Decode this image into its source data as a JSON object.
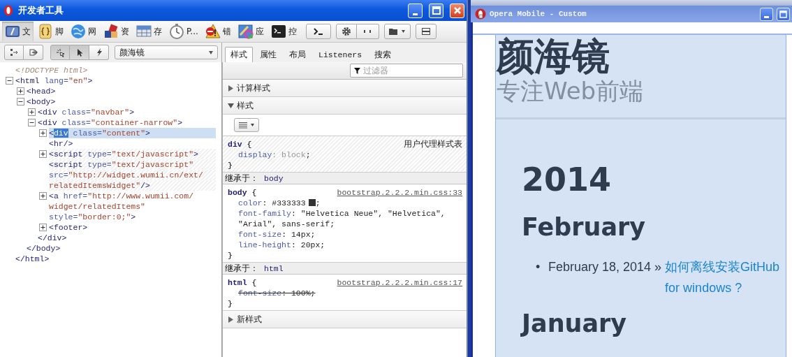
{
  "devtools": {
    "title": "开发者工具",
    "tools": [
      {
        "label": "文",
        "selected": true
      },
      {
        "label": "脚",
        "selected": false
      },
      {
        "label": "网",
        "selected": false
      },
      {
        "label": "资",
        "selected": false
      },
      {
        "label": "存",
        "selected": false
      },
      {
        "label": "P...",
        "selected": false
      },
      {
        "label": "错",
        "selected": false
      },
      {
        "label": "应",
        "selected": false
      },
      {
        "label": "控",
        "selected": false
      }
    ],
    "pick_modes": [
      {
        "selected": true
      },
      {
        "selected": true
      },
      {
        "selected": false
      }
    ],
    "document_select": {
      "value": "颜海镜"
    },
    "panel_tabs": [
      {
        "label": "样式",
        "selected": true
      },
      {
        "label": "属性",
        "selected": false
      },
      {
        "label": "布局",
        "selected": false
      },
      {
        "label": "Listeners",
        "selected": false
      },
      {
        "label": "搜索",
        "selected": false
      }
    ],
    "filter": {
      "placeholder": "过滤器"
    },
    "dom_tree": [
      {
        "lines": [
          [
            {
              "kind": "doctype",
              "text": "<!DOCTYPE html>"
            }
          ]
        ],
        "selected": false,
        "hatched": false
      },
      {
        "lines": [
          [
            {
              "kind": "tag",
              "text": "<html"
            },
            {
              "kind": "attr",
              "text": " lang="
            },
            {
              "kind": "value",
              "text": "\"en\""
            },
            {
              "kind": "tag",
              "text": ">"
            }
          ]
        ],
        "expanded": true,
        "selected": false,
        "hatched": false,
        "closing": [
          {
            "kind": "tag",
            "text": "</html>"
          }
        ],
        "children": [
          {
            "lines": [
              [
                {
                  "kind": "tag",
                  "text": "<head>"
                }
              ]
            ],
            "expanded": false,
            "selected": false,
            "hatched": false
          },
          {
            "lines": [
              [
                {
                  "kind": "tag",
                  "text": "<body>"
                }
              ]
            ],
            "expanded": true,
            "selected": false,
            "hatched": false,
            "closing": [
              {
                "kind": "tag",
                "text": "</body>"
              }
            ],
            "children": [
              {
                "lines": [
                  [
                    {
                      "kind": "tag",
                      "text": "<div"
                    },
                    {
                      "kind": "attr",
                      "text": " class="
                    },
                    {
                      "kind": "value",
                      "text": "\"navbar\""
                    },
                    {
                      "kind": "tag",
                      "text": ">"
                    }
                  ]
                ],
                "expanded": false,
                "selected": false,
                "hatched": false
              },
              {
                "lines": [
                  [
                    {
                      "kind": "tag",
                      "text": "<div"
                    },
                    {
                      "kind": "attr",
                      "text": " class="
                    },
                    {
                      "kind": "value",
                      "text": "\"container-narrow\""
                    },
                    {
                      "kind": "tag",
                      "text": ">"
                    }
                  ]
                ],
                "expanded": true,
                "selected": false,
                "hatched": false,
                "closing": [
                  {
                    "kind": "tag",
                    "text": "</div>"
                  }
                ],
                "children": [
                  {
                    "lines": [
                      [
                        {
                          "kind": "tag",
                          "text": "<"
                        },
                        {
                          "kind": "highlight",
                          "text": "div"
                        },
                        {
                          "kind": "attr",
                          "text": " class="
                        },
                        {
                          "kind": "value",
                          "text": "\"content\""
                        },
                        {
                          "kind": "tag",
                          "text": ">"
                        }
                      ]
                    ],
                    "expanded": false,
                    "selected": true,
                    "hatched": false
                  },
                  {
                    "lines": [
                      [
                        {
                          "kind": "tag",
                          "text": "<hr/>"
                        }
                      ]
                    ],
                    "selected": false,
                    "hatched": false
                  },
                  {
                    "lines": [
                      [
                        {
                          "kind": "tag",
                          "text": "<script"
                        },
                        {
                          "kind": "attr",
                          "text": " type="
                        },
                        {
                          "kind": "value",
                          "text": "\"text/javascript\""
                        },
                        {
                          "kind": "tag",
                          "text": ">"
                        }
                      ]
                    ],
                    "expanded": false,
                    "selected": false,
                    "hatched": true
                  },
                  {
                    "lines": [
                      [
                        {
                          "kind": "tag",
                          "text": "<script"
                        },
                        {
                          "kind": "attr",
                          "text": " type="
                        },
                        {
                          "kind": "value",
                          "text": "\"text/javascript\""
                        }
                      ],
                      [
                        {
                          "kind": "attr",
                          "text": "src="
                        },
                        {
                          "kind": "value",
                          "text": "\"http://widget.wumii.cn/ext/"
                        }
                      ],
                      [
                        {
                          "kind": "value",
                          "text": "relatedItemsWidget\""
                        },
                        {
                          "kind": "tag",
                          "text": "/>"
                        }
                      ]
                    ],
                    "selected": false,
                    "hatched": true
                  },
                  {
                    "lines": [
                      [
                        {
                          "kind": "tag",
                          "text": "<a"
                        },
                        {
                          "kind": "attr",
                          "text": " href="
                        },
                        {
                          "kind": "value",
                          "text": "\"http://www.wumii.com/"
                        }
                      ],
                      [
                        {
                          "kind": "value",
                          "text": "widget/relatedItems\""
                        }
                      ],
                      [
                        {
                          "kind": "attr",
                          "text": "style="
                        },
                        {
                          "kind": "value",
                          "text": "\"border:0;\""
                        },
                        {
                          "kind": "tag",
                          "text": ">"
                        }
                      ]
                    ],
                    "expanded": false,
                    "selected": false,
                    "hatched": false
                  },
                  {
                    "lines": [
                      [
                        {
                          "kind": "tag",
                          "text": "<footer>"
                        }
                      ]
                    ],
                    "expanded": false,
                    "selected": false,
                    "hatched": false
                  }
                ]
              }
            ]
          }
        ]
      }
    ],
    "style_sections": [
      {
        "label": "计算样式",
        "expanded": false
      },
      {
        "label": "样式",
        "expanded": true,
        "blocks": [
          {
            "kind": "rule",
            "selector": "div",
            "open": " {",
            "close": "}",
            "origin": "用户代理样式表",
            "user_agent": true,
            "declarations": [
              {
                "property": "display",
                "value": ": block",
                "end": ";",
                "overridden": false
              }
            ]
          },
          {
            "kind": "inherited",
            "label": "继承于：",
            "selector": "body"
          },
          {
            "kind": "rule",
            "selector": "body",
            "open": " {",
            "close": "}",
            "origin": "bootstrap.2.2.2.min.css:33",
            "user_agent": false,
            "declarations": [
              {
                "property": "color",
                "value": ": #333333",
                "color": "#333333",
                "end": ";",
                "overridden": false
              },
              {
                "property": "font-family",
                "value": ": \"Helvetica Neue\", \"Helvetica\", \"Arial\", sans-serif",
                "end": ";",
                "overridden": false
              },
              {
                "property": "font-size",
                "value": ": 14px",
                "end": ";",
                "overridden": false
              },
              {
                "property": "line-height",
                "value": ": 20px",
                "end": ";",
                "overridden": false
              }
            ]
          },
          {
            "kind": "inherited",
            "label": "继承于：",
            "selector": "html"
          },
          {
            "kind": "rule",
            "selector": "html",
            "open": " {",
            "close": "}",
            "origin": "bootstrap.2.2.2.min.css:17",
            "user_agent": false,
            "declarations": [
              {
                "property": "font-size",
                "value": ": 100%",
                "end": ";",
                "overridden": true
              }
            ]
          }
        ]
      },
      {
        "label": "新样式",
        "expanded": false
      }
    ]
  },
  "mobile": {
    "title": "Opera Mobile - Custom",
    "site_title": "颜海镜",
    "tagline": "专注Web前端",
    "archive": [
      {
        "year": "2014",
        "months": [
          {
            "name": "February",
            "posts": [
              {
                "marker": "•",
                "date": "February 18, 2014 »",
                "link": "如何离线安装GitHub for windows ?"
              }
            ]
          },
          {
            "name": "January"
          }
        ]
      }
    ]
  }
}
